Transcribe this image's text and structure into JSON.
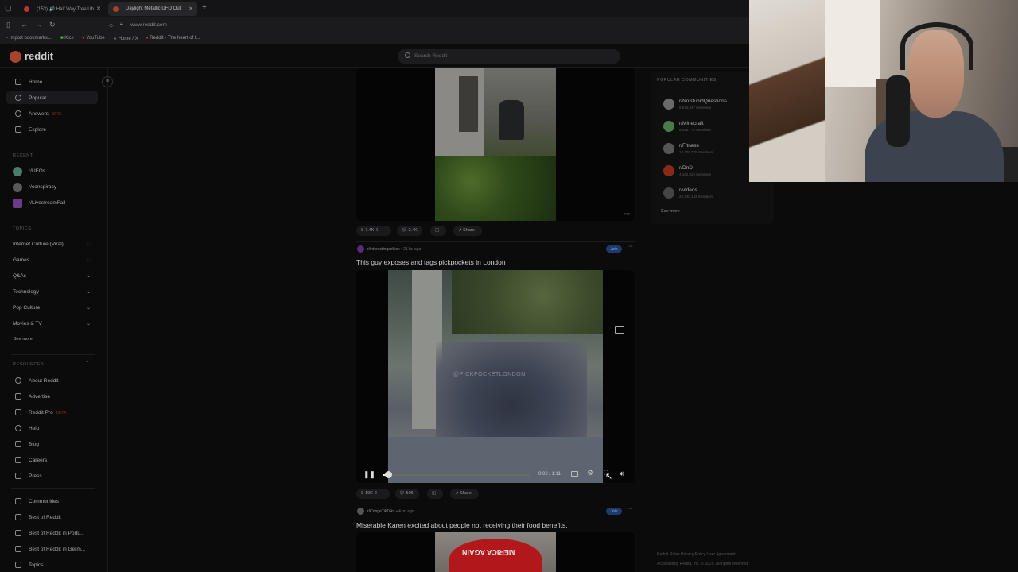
{
  "browser": {
    "tabs": [
      {
        "label": "(153) 🔊 Half Way Tree Uh",
        "active": false
      },
      {
        "label": "Daylight Metallic UFO Out",
        "active": true
      }
    ],
    "url": "www.reddit.com",
    "bookmarks": [
      "Import bookmarks...",
      "Kick",
      "YouTube",
      "Home / X",
      "Reddit - The heart of t..."
    ]
  },
  "header": {
    "logo": "reddit",
    "search_placeholder": "Search Reddit"
  },
  "sidebar": {
    "nav": [
      {
        "label": "Home",
        "icon": "home-icon",
        "active": false
      },
      {
        "label": "Popular",
        "icon": "popular-icon",
        "active": true
      },
      {
        "label": "Answers",
        "icon": "answers-icon",
        "badge": "BETA"
      },
      {
        "label": "Explore",
        "icon": "explore-icon"
      }
    ],
    "recent_header": "RECENT",
    "recent": [
      {
        "label": "r/UFOs",
        "color": "#4a7c6a"
      },
      {
        "label": "r/conspiracy",
        "color": "#5a5a5a"
      },
      {
        "label": "r/LivestreamFail",
        "color": "#6b3b8a"
      }
    ],
    "topics_header": "TOPICS",
    "topics": [
      "Internet Culture (Viral)",
      "Games",
      "Q&As",
      "Technology",
      "Pop Culture",
      "Movies & TV"
    ],
    "see_more": "See more",
    "resources_header": "RESOURCES",
    "resources": [
      {
        "label": "About Reddit",
        "icon": "reddit-icon"
      },
      {
        "label": "Advertise",
        "icon": "advertise-icon"
      },
      {
        "label": "Reddit Pro",
        "icon": "pro-icon",
        "badge": "BETA"
      },
      {
        "label": "Help",
        "icon": "help-icon"
      },
      {
        "label": "Blog",
        "icon": "blog-icon"
      },
      {
        "label": "Careers",
        "icon": "careers-icon"
      },
      {
        "label": "Press",
        "icon": "press-icon"
      }
    ],
    "bottom": [
      {
        "label": "Communities",
        "icon": "communities-icon"
      },
      {
        "label": "Best of Reddit",
        "icon": "best-icon"
      },
      {
        "label": "Best of Reddit in Portu...",
        "icon": "best-icon"
      },
      {
        "label": "Best of Reddit in Germ...",
        "icon": "best-icon"
      },
      {
        "label": "Topics",
        "icon": "topics-icon"
      }
    ]
  },
  "feed": {
    "post1": {
      "votes": "7.4K",
      "comments": "2.4K",
      "share": "Share",
      "gif_badge": "GIF"
    },
    "post2": {
      "subreddit": "r/interestingasfuck",
      "age": "• 21 hr. ago",
      "title": "This guy exposes and tags pickpockets in London",
      "join": "Join",
      "time": "0:02 / 1:11",
      "progress": 0.03,
      "watermark": "@PICKPOCKETLONDON",
      "votes": "19K",
      "comments": "506",
      "share": "Share"
    },
    "post3": {
      "subreddit": "r/CringeTikToks",
      "age": "• 4 hr. ago",
      "title": "Miserable Karen excited about people not receiving their food benefits.",
      "join": "Join",
      "hat_text": "MERICA AGAIN"
    }
  },
  "right": {
    "popular_header": "POPULAR COMMUNITIES",
    "communities": [
      {
        "name": "r/NoStupidQuestions",
        "members": "6,613,047 members",
        "color": "#6a6a6a"
      },
      {
        "name": "r/Minecraft",
        "members": "8,515,775 members",
        "color": "#4a7c4a"
      },
      {
        "name": "r/Fitness",
        "members": "12,426,779 members",
        "color": "#555555"
      },
      {
        "name": "r/DnD",
        "members": "4,162,825 members",
        "color": "#8a2a16"
      },
      {
        "name": "r/videos",
        "members": "26,740,143 members",
        "color": "#444444"
      }
    ],
    "see_more": "See more",
    "footer_line1": "Reddit Rules   Privacy Policy   User Agreement",
    "footer_line2": "Accessibility   Reddit, Inc. © 2025. All rights reserved."
  }
}
